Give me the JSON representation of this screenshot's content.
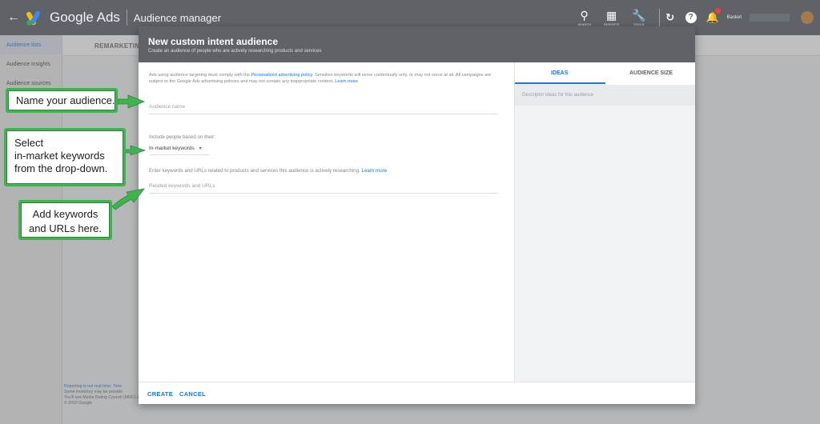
{
  "topbar": {
    "brand": "Google",
    "brand_sub": "Ads",
    "section": "Audience manager",
    "tools": [
      {
        "icon": "search-icon",
        "label": "SEARCH"
      },
      {
        "icon": "reports-icon",
        "label": "REPORTS"
      },
      {
        "icon": "tools-icon",
        "label": "TOOLS"
      }
    ],
    "account": "Basket"
  },
  "leftnav": {
    "items": [
      "Audience lists",
      "Audience insights",
      "Audience sources"
    ]
  },
  "background_tab": "REMARKETING",
  "footer": {
    "line1": "Reporting is not real-time. Time",
    "line2": "Some inventory may be provide",
    "line3": "You'll see Media Rating Council (MRC) accreditation noted in the column header's hover text for accredited metrics.",
    "line4": "© 2019 Google"
  },
  "dialog": {
    "title": "New custom intent audience",
    "subtitle": "Create an audience of people who are actively researching products and services",
    "policy_pre": "Ads using audience targeting must comply with the ",
    "policy_link": "Personalized advertising policy",
    "policy_mid": ". Sensitive keywords will serve contextually only, or may not serve at all. All campaigns are subject to the Google Ads advertising policies and may not contain any inappropriate content. ",
    "policy_learn": "Learn more",
    "audience_name_placeholder": "Audience name",
    "include_label": "Include people based on their:",
    "dropdown_value": "In-market keywords",
    "enter_text": "Enter keywords and URLs related to products and services this audience is actively researching. ",
    "enter_learn": "Learn more",
    "keywords_placeholder": "Related keywords and URLs",
    "tabs": [
      "IDEAS",
      "AUDIENCE SIZE"
    ],
    "ideas_description": "Descriptor ideas for this audience",
    "create_label": "CREATE",
    "cancel_label": "CANCEL"
  },
  "callouts": {
    "name": "Name your audience.",
    "select": [
      "Select",
      "in-market keywords",
      "from the drop-down."
    ],
    "add": [
      "Add keywords",
      "and URLs here."
    ]
  },
  "colors": {
    "accent": "#1a73e8",
    "callout_border": "#3fb34f",
    "header": "#5f6368"
  }
}
